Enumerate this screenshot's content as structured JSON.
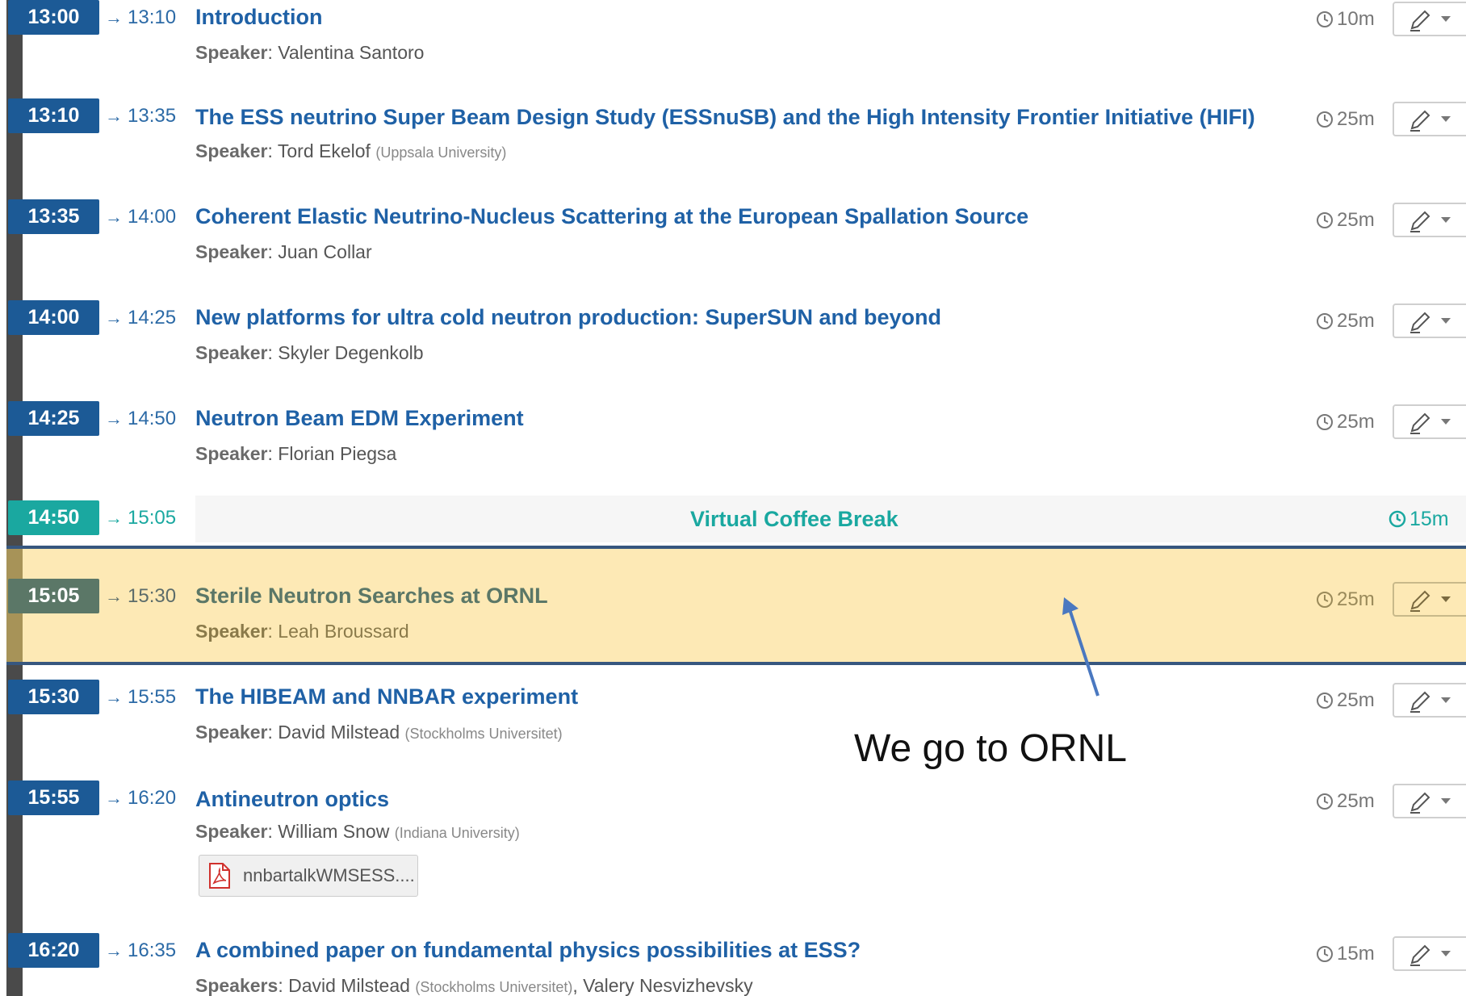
{
  "colors": {
    "accent": "#1c5a96",
    "break": "#1aa8a0",
    "highlight": "#fde9b5",
    "highlight_border": "#37577f"
  },
  "entries": [
    {
      "start": "13:00",
      "end": "13:10",
      "title": "Introduction",
      "speaker_label": "Speaker",
      "speaker": "Valentina Santoro",
      "affiliation": "",
      "duration": "10m"
    },
    {
      "start": "13:10",
      "end": "13:35",
      "title": "The ESS neutrino Super Beam Design Study (ESSnuSB) and the High Intensity Frontier Initiative (HIFI)",
      "speaker_label": "Speaker",
      "speaker": "Tord Ekelof",
      "affiliation": "(Uppsala University)",
      "duration": "25m"
    },
    {
      "start": "13:35",
      "end": "14:00",
      "title": "Coherent Elastic Neutrino-Nucleus Scattering at the European Spallation Source",
      "speaker_label": "Speaker",
      "speaker": "Juan Collar",
      "affiliation": "",
      "duration": "25m"
    },
    {
      "start": "14:00",
      "end": "14:25",
      "title": "New platforms for ultra cold neutron production: SuperSUN and beyond",
      "speaker_label": "Speaker",
      "speaker": "Skyler Degenkolb",
      "affiliation": "",
      "duration": "25m"
    },
    {
      "start": "14:25",
      "end": "14:50",
      "title": "Neutron Beam EDM Experiment",
      "speaker_label": "Speaker",
      "speaker": "Florian Piegsa",
      "affiliation": "",
      "duration": "25m"
    },
    {
      "start": "15:05",
      "end": "15:30",
      "title": "Sterile Neutron Searches at ORNL",
      "speaker_label": "Speaker",
      "speaker": "Leah Broussard",
      "affiliation": "",
      "duration": "25m"
    },
    {
      "start": "15:30",
      "end": "15:55",
      "title": "The HIBEAM and NNBAR experiment",
      "speaker_label": "Speaker",
      "speaker": "David Milstead",
      "affiliation": "(Stockholms Universitet)",
      "duration": "25m"
    },
    {
      "start": "15:55",
      "end": "16:20",
      "title": "Antineutron optics",
      "speaker_label": "Speaker",
      "speaker": "William Snow",
      "affiliation": "(Indiana University)",
      "duration": "25m",
      "attachment": "nnbartalkWMSESS...."
    },
    {
      "start": "16:20",
      "end": "16:35",
      "title": "A combined paper on fundamental physics possibilities at ESS?",
      "speaker_label": "Speakers",
      "speaker": "David Milstead",
      "affiliation": "(Stockholms Universitet)",
      "speaker2": ", Valery Nesvizhevsky",
      "duration": "15m"
    }
  ],
  "break": {
    "start": "14:50",
    "end": "15:05",
    "title": "Virtual Coffee Break",
    "duration": "15m"
  },
  "annotation": {
    "text": "We go to ORNL"
  },
  "arrow_glyph": "→"
}
